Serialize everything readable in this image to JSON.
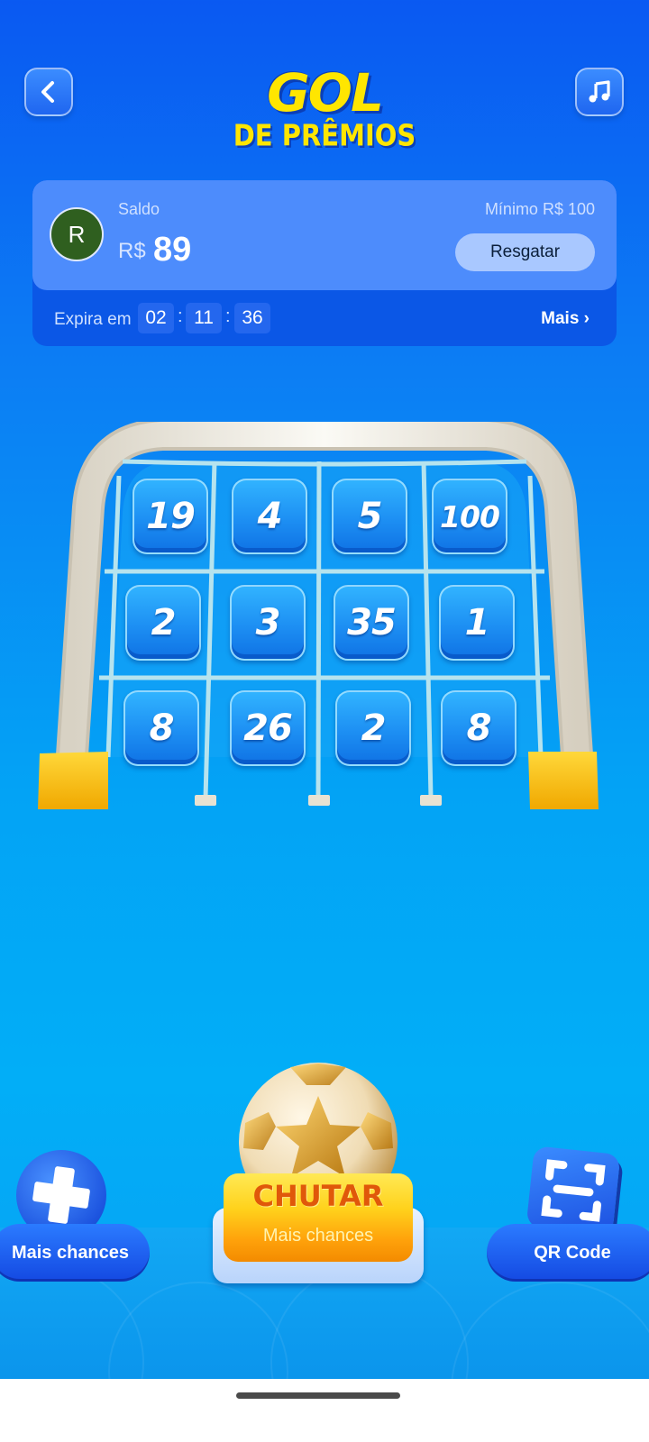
{
  "header": {
    "logo_line1": "GOL",
    "logo_line2": "DE PRÊMIOS",
    "back_icon": "chevron-left-icon",
    "music_icon": "music-note-icon"
  },
  "balance": {
    "avatar_letter": "R",
    "saldo_label": "Saldo",
    "currency": "R$",
    "amount": "89",
    "minimum_label": "Mínimo R$ 100",
    "redeem_label": "Resgatar",
    "expires_label": "Expira em",
    "timer": {
      "hours": "02",
      "minutes": "11",
      "seconds": "36",
      "separator": ":"
    },
    "more_label": "Mais ›"
  },
  "grid": {
    "tiles": [
      "19",
      "4",
      "5",
      "100",
      "2",
      "3",
      "35",
      "1",
      "8",
      "26",
      "2",
      "8"
    ]
  },
  "actions": {
    "kick_label": "CHUTAR",
    "kick_sub_label": "Mais chances",
    "more_chances_label": "Mais chances",
    "qr_label": "QR Code"
  },
  "colors": {
    "logo_yellow": "#ffe600",
    "card_top": "#4d8cfc",
    "card_bottom": "#0b57e6",
    "kick_orange": "#e0580a"
  }
}
